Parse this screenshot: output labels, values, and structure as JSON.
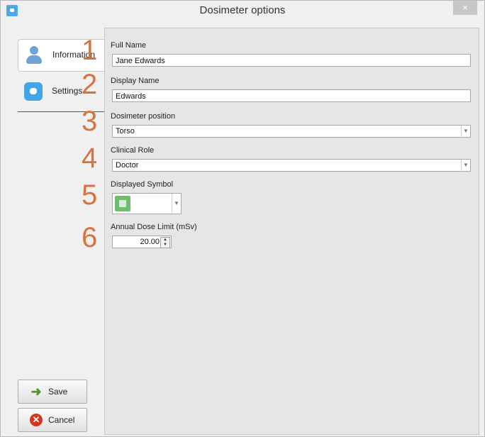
{
  "window": {
    "title": "Dosimeter options",
    "close_glyph": "×"
  },
  "sidebar": {
    "tabs": [
      {
        "label": "Information",
        "icon": "person-icon",
        "active": true
      },
      {
        "label": "Settings",
        "icon": "settings-icon",
        "active": false
      }
    ],
    "save_label": "Save",
    "cancel_label": "Cancel"
  },
  "form": {
    "full_name": {
      "label": "Full Name",
      "value": "Jane Edwards"
    },
    "display_name": {
      "label": "Display Name",
      "value": "Edwards"
    },
    "dosimeter_position": {
      "label": "Dosimeter position",
      "value": "Torso"
    },
    "clinical_role": {
      "label": "Clinical Role",
      "value": "Doctor"
    },
    "displayed_symbol": {
      "label": "Displayed Symbol",
      "value": "green square"
    },
    "annual_dose_limit": {
      "label": "Annual Dose Limit (mSv)",
      "value": "20.00"
    }
  },
  "callouts": [
    "1",
    "2",
    "3",
    "4",
    "5",
    "6"
  ],
  "colors": {
    "accent": "#41a5e6",
    "callout": "#d9723c",
    "panel": "#e6e6e6",
    "symbol_green": "#6fbe6f"
  }
}
